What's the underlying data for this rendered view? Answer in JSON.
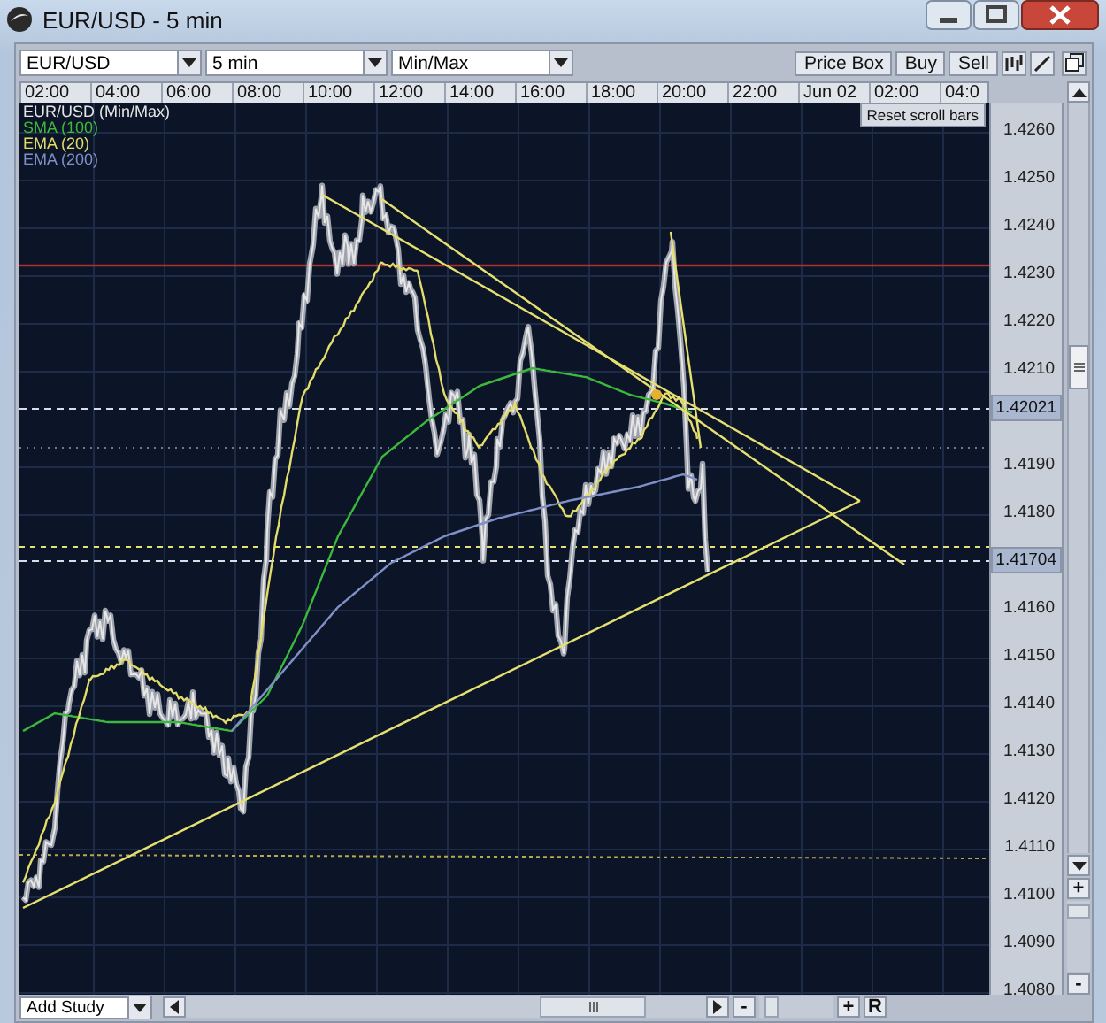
{
  "window": {
    "title": "EUR/USD - 5 min"
  },
  "toolbar": {
    "symbol": "EUR/USD",
    "interval": "5 min",
    "mode": "Min/Max",
    "buttons": [
      "Price Box",
      "Buy",
      "Sell"
    ]
  },
  "time_axis": [
    "02:00",
    "04:00",
    "06:00",
    "08:00",
    "10:00",
    "12:00",
    "14:00",
    "16:00",
    "18:00",
    "20:00",
    "22:00",
    "Jun 02",
    "02:00",
    "04:0"
  ],
  "legend": [
    {
      "label": "EUR/USD (Min/Max)",
      "color": "#e6e6e6"
    },
    {
      "label": "SMA (100)",
      "color": "#3cb83c"
    },
    {
      "label": "EMA (20)",
      "color": "#e3dc6a"
    },
    {
      "label": "EMA (200)",
      "color": "#7f8fc8"
    }
  ],
  "reset_button": "Reset scroll bars",
  "price_axis": [
    "1.4260",
    "1.4250",
    "1.4240",
    "1.4230",
    "1.4220",
    "1.4210",
    "1.4190",
    "1.4180",
    "1.4160",
    "1.4150",
    "1.4140",
    "1.4130",
    "1.4120",
    "1.4110",
    "1.4100",
    "1.4090",
    "1.4080"
  ],
  "price_markers": [
    "1.42021",
    "1.41704"
  ],
  "bottom_bar": {
    "add_study": "Add Study",
    "zoom_in": "+",
    "zoom_out": "-",
    "reset": "R",
    "zoom_in_side": "+",
    "zoom_out_side": "-"
  }
}
